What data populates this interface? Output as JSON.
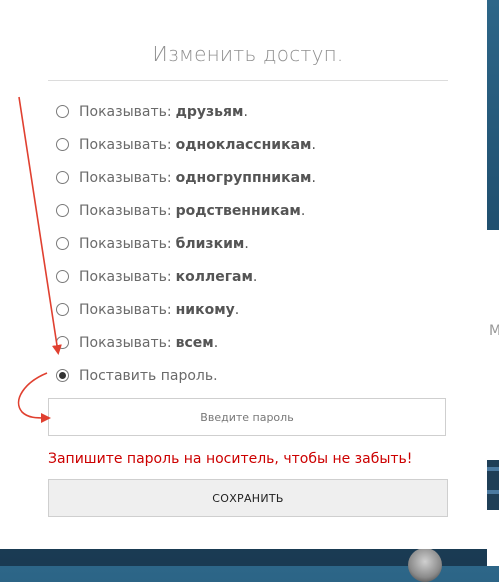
{
  "dialog": {
    "title": "Изменить доступ."
  },
  "options": [
    {
      "prefix": "Показывать",
      "sep": " :",
      "target": "друзьям",
      "dot": ".",
      "checked": false
    },
    {
      "prefix": "Показывать",
      "sep": " :",
      "target": "одноклассникам",
      "dot": ".",
      "checked": false
    },
    {
      "prefix": "Показывать",
      "sep": " :",
      "target": "одногруппникам",
      "dot": ".",
      "checked": false
    },
    {
      "prefix": "Показывать",
      "sep": " :",
      "target": "родственникам",
      "dot": ".",
      "checked": false
    },
    {
      "prefix": "Показывать",
      "sep": " :",
      "target": "близким",
      "dot": ".",
      "checked": false
    },
    {
      "prefix": "Показывать",
      "sep": " :",
      "target": "коллегам",
      "dot": ".",
      "checked": false
    },
    {
      "prefix": "Показывать",
      "sep": " :",
      "target": "никому",
      "dot": ".",
      "checked": false
    },
    {
      "prefix": "Показывать",
      "sep": " :",
      "target": "всем",
      "dot": ".",
      "checked": false
    },
    {
      "prefix": "Поставить пароль.",
      "sep": "",
      "target": "",
      "dot": "",
      "checked": true
    }
  ],
  "password_field": {
    "value": "",
    "placeholder": "Введите пароль"
  },
  "warning_text": "Запишите пароль на носитель, чтобы не забыть!",
  "save_label": "СОХРАНИТЬ",
  "background": {
    "right_edge_char": "M"
  },
  "colors": {
    "annotation_arrow": "#e04030",
    "warning": "#cc0000",
    "background": "#2d6688"
  }
}
